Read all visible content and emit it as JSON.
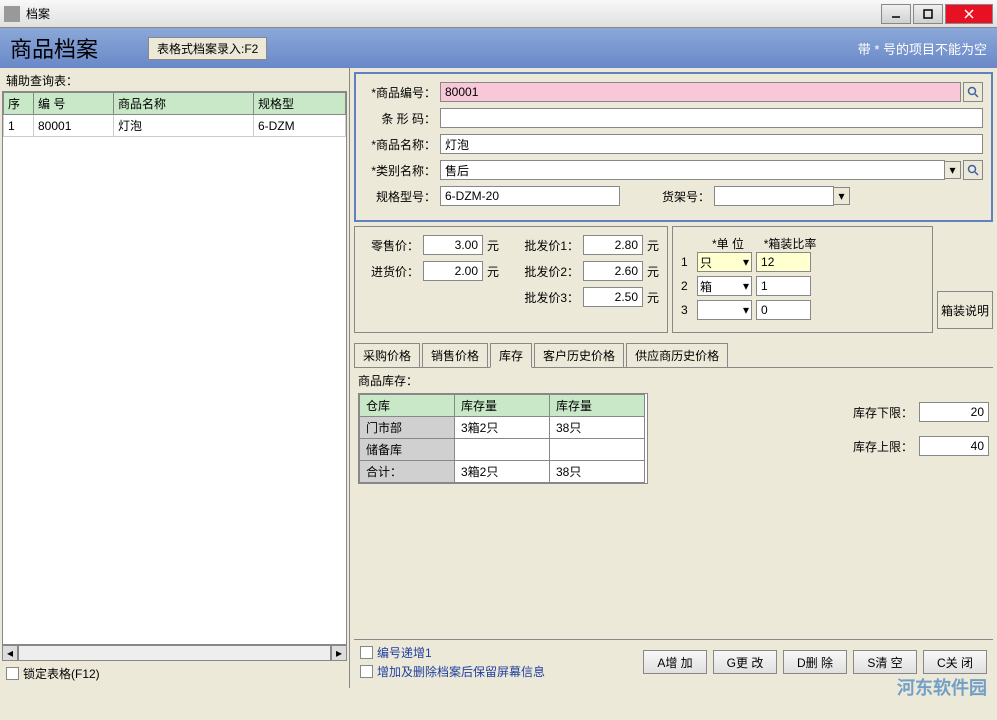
{
  "window": {
    "title": "档案"
  },
  "header": {
    "title": "商品档案",
    "f2_button": "表格式档案录入:F2",
    "note": "带 * 号的项目不能为空"
  },
  "left": {
    "label": "辅助查询表：",
    "columns": [
      "序",
      "编 号",
      "商品名称",
      "规格型"
    ],
    "rows": [
      {
        "seq": "1",
        "code": "80001",
        "name": "灯泡",
        "spec": "6-DZM"
      }
    ],
    "lock_label": "锁定表格(F12)"
  },
  "form": {
    "code_label": "*商品编号：",
    "code_value": "80001",
    "barcode_label": "条 形 码：",
    "barcode_value": "",
    "name_label": "*商品名称：",
    "name_value": "灯泡",
    "cat_label": "*类别名称：",
    "cat_value": "售后",
    "spec_label": "规格型号：",
    "spec_value": "6-DZM-20",
    "shelf_label": "货架号：",
    "shelf_value": ""
  },
  "prices": {
    "retail_label": "零售价：",
    "retail": "3.00",
    "yuan": "元",
    "cost_label": "进货价：",
    "cost": "2.00",
    "wh1_label": "批发价1：",
    "wh1": "2.80",
    "wh2_label": "批发价2：",
    "wh2": "2.60",
    "wh3_label": "批发价3：",
    "wh3": "2.50"
  },
  "units": {
    "unit_header": "*单 位",
    "ratio_header": "*箱装比率",
    "rows": [
      {
        "n": "1",
        "unit": "只",
        "ratio": "12"
      },
      {
        "n": "2",
        "unit": "箱",
        "ratio": "1"
      },
      {
        "n": "3",
        "unit": "",
        "ratio": "0"
      }
    ],
    "box_desc": "箱装说明"
  },
  "tabs": [
    "采购价格",
    "销售价格",
    "库存",
    "客户历史价格",
    "供应商历史价格"
  ],
  "stock": {
    "label": "商品库存：",
    "columns": [
      "仓库",
      "库存量",
      "库存量"
    ],
    "rows": [
      {
        "wh": "门市部",
        "q1": "3箱2只",
        "q2": "38只"
      },
      {
        "wh": "储备库",
        "q1": "",
        "q2": ""
      },
      {
        "wh": "合计：",
        "q1": "3箱2只",
        "q2": "38只"
      }
    ],
    "lower_label": "库存下限：",
    "lower": "20",
    "upper_label": "库存上限：",
    "upper": "40"
  },
  "footer": {
    "auto_inc": "编号递增1",
    "keep_info": "增加及删除档案后保留屏幕信息",
    "btn_add": "A增 加",
    "btn_mod": "G更 改",
    "btn_del": "D删 除",
    "btn_clear": "S清 空",
    "btn_close": "C关 闭"
  },
  "watermark": "河东软件园"
}
